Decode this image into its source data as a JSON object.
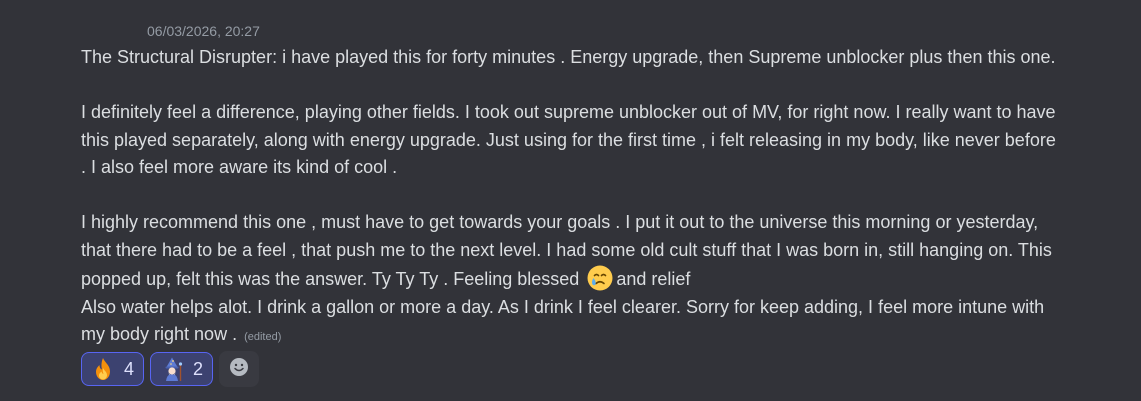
{
  "message": {
    "timestamp": "06/03/2026, 20:27",
    "lines": [
      "The Structural Disrupter: i have played this for forty minutes . Energy upgrade, then Supreme unblocker plus  then this one.",
      "I definitely feel a difference, playing other fields. I took out supreme unblocker out of MV, for right now. I really want to have",
      "this played separately, along with energy upgrade. Just using  for the first time , i felt releasing in my body, like never before",
      ". I also feel more aware its kind of cool .",
      "I highly recommend this one , must have  to get towards your goals . I put it out to the universe this morning or yesterday,",
      "that there had to be a feel , that push me to the next level. I had some old cult stuff that I was born in, still hanging on. This",
      "popped up, felt this was the answer. Ty Ty Ty . Feeling blessed",
      "and relief",
      "Also water helps alot. I drink a gallon or more a day. As I drink I feel clearer. Sorry for keep adding, I feel more intune with",
      "my body right now ."
    ],
    "edited_label": "(edited)",
    "inline_emoji": "crying-face-emoji"
  },
  "reactions": [
    {
      "emoji": "fire-emoji",
      "count": "4"
    },
    {
      "emoji": "mage-emoji",
      "count": "2"
    }
  ],
  "add_reaction": {
    "icon": "add-reaction-smiley-icon"
  },
  "colors": {
    "background": "#323339",
    "text": "#dbdee1",
    "muted": "#949ba4",
    "reaction_border": "#5865f2",
    "reaction_bg": "#3c4270"
  }
}
